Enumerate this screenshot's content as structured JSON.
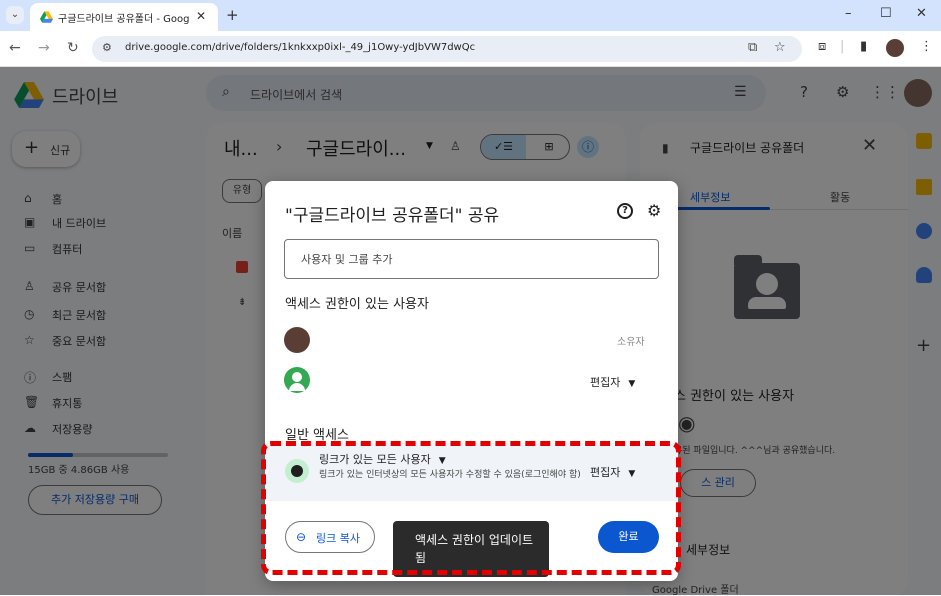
{
  "browser": {
    "tab_title": "구글드라이브 공유폴더 - Goog",
    "url": "drive.google.com/drive/folders/1knkxxp0ixl-_49_j1Owy-ydJbVW7dwQc"
  },
  "drive": {
    "app_name": "드라이브",
    "search_placeholder": "드라이브에서 검색",
    "new_label": "신규",
    "sidebar": [
      {
        "icon": "home-icon",
        "glyph": "⌂",
        "label": "홈"
      },
      {
        "icon": "my-drive-icon",
        "glyph": "▣",
        "label": "내 드라이브"
      },
      {
        "icon": "computer-icon",
        "glyph": "▭",
        "label": "컴퓨터"
      },
      {
        "icon": "shared-icon",
        "glyph": "♙",
        "label": "공유 문서함"
      },
      {
        "icon": "recent-icon",
        "glyph": "◷",
        "label": "최근 문서함"
      },
      {
        "icon": "star-icon",
        "glyph": "☆",
        "label": "중요 문서함"
      },
      {
        "icon": "spam-icon",
        "glyph": "ⓘ",
        "label": "스팸"
      },
      {
        "icon": "trash-icon",
        "glyph": "🗑",
        "label": "휴지통"
      },
      {
        "icon": "cloud-icon",
        "glyph": "☁",
        "label": "저장용량"
      }
    ],
    "storage": {
      "used_fraction": 0.32,
      "text": "15GB 중 4.86GB 사용"
    },
    "buy_storage": "추가 저장용량 구매",
    "breadcrumb_root": "내...",
    "breadcrumb_current": "구글드라이...",
    "filter_chip": "유형",
    "column_name": "이름",
    "details": {
      "title": "구글드라이브 공유폴더",
      "tab_details": "세부정보",
      "tab_activity": "활동",
      "who_has_access": "스 권한이 있는 사용자",
      "permission_text": "유된 파일입니다. ^^^님과 공유했습니다.",
      "manage_access": "스 관리",
      "section_details": "세부정보",
      "section_sub": "Google Drive 폴더"
    }
  },
  "dialog": {
    "title": "\"구글드라이브 공유폴더\" 공유",
    "add_placeholder": "사용자 및 그룹 추가",
    "who_has_access": "액세스 권한이 있는 사용자",
    "users": [
      {
        "role": "소유자",
        "avatar_color": "#5a3e36"
      },
      {
        "role": "편집자",
        "avatar_color": "#34a853"
      }
    ],
    "general_access": "일반 액세스",
    "link_option": "링크가 있는 모든 사용자",
    "link_desc": "링크가 있는 인터넷상의 모든 사용자가 수정할 수 있음(로그인해야 함)",
    "link_role": "편집자",
    "copy_link": "링크 복사",
    "done": "완료"
  },
  "toast": "액세스 권한이 업데이트됨",
  "colors": {
    "accent": "#0b57d0",
    "highlight": "#e00000"
  }
}
